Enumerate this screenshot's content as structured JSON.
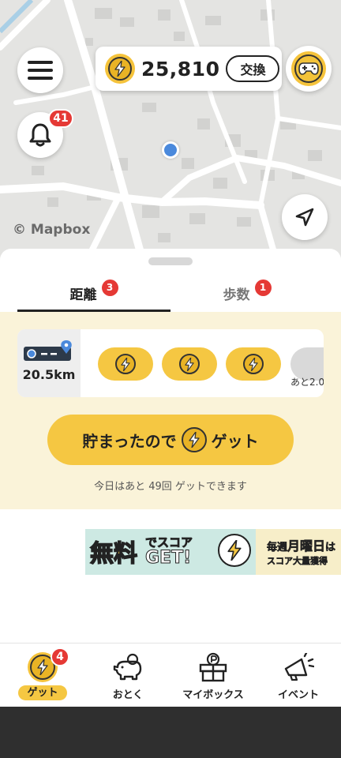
{
  "map": {
    "attribution": "© Mapbox"
  },
  "header": {
    "notification_count": "41",
    "score": "25,810",
    "exchange_label": "交換"
  },
  "tabs": [
    {
      "label": "距離",
      "badge": "3",
      "active": true
    },
    {
      "label": "歩数",
      "badge": "1",
      "active": false
    }
  ],
  "distance": {
    "value": "20.5km",
    "remaining_text": "あと2.0"
  },
  "get_panel": {
    "button_label_pre": "貯まったので",
    "button_label_post": "ゲット",
    "note": "今日はあと 49回 ゲットできます"
  },
  "banner": {
    "left_text_1": "無料",
    "left_text_2": "でスコア",
    "left_text_3": "GET!",
    "right_text_1": "毎週",
    "right_text_2": "月曜日",
    "right_text_3": "は",
    "right_text_4": "スコア大量獲得"
  },
  "bottom_nav": [
    {
      "label": "ゲット",
      "badge": "4",
      "active": true
    },
    {
      "label": "おとく"
    },
    {
      "label": "マイボックス"
    },
    {
      "label": "イベント"
    }
  ],
  "colors": {
    "accent": "#f5c742",
    "badge": "#e53935",
    "panel_bg": "#faf3d9",
    "location": "#4a89dc"
  }
}
